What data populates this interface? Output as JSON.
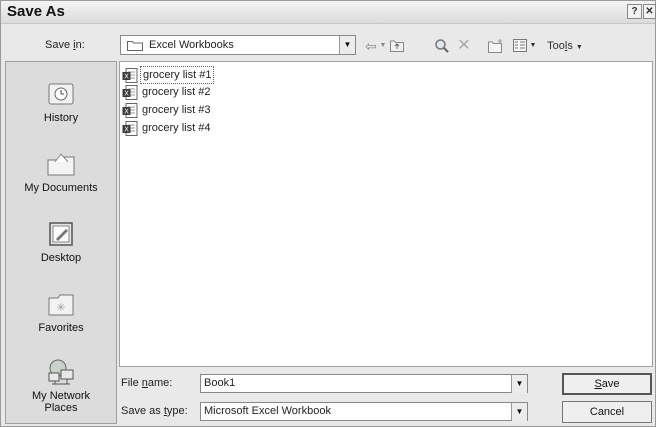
{
  "dialog": {
    "title": "Save As",
    "help_glyph": "?",
    "close_glyph": "✕"
  },
  "savein": {
    "label_pre": "Save ",
    "label_key": "i",
    "label_post": "n:",
    "value": "Excel Workbooks"
  },
  "toolbar": {
    "tools_pre": "Too",
    "tools_key": "l",
    "tools_post": "s"
  },
  "places": {
    "history": "History",
    "documents": "My Documents",
    "desktop": "Desktop",
    "favorites": "Favorites",
    "network_line1": "My Network",
    "network_line2": "Places"
  },
  "files": [
    {
      "name": "grocery list #1",
      "selected": true
    },
    {
      "name": "grocery list #2",
      "selected": false
    },
    {
      "name": "grocery list #3",
      "selected": false
    },
    {
      "name": "grocery list #4",
      "selected": false
    }
  ],
  "filename": {
    "label_pre": "File ",
    "label_key": "n",
    "label_post": "ame:",
    "value": "Book1"
  },
  "filetype": {
    "label_pre": "Save as ",
    "label_key": "t",
    "label_post": "ype:",
    "value": "Microsoft Excel Workbook"
  },
  "buttons": {
    "save_key": "S",
    "save_post": "ave",
    "cancel": "Cancel"
  }
}
